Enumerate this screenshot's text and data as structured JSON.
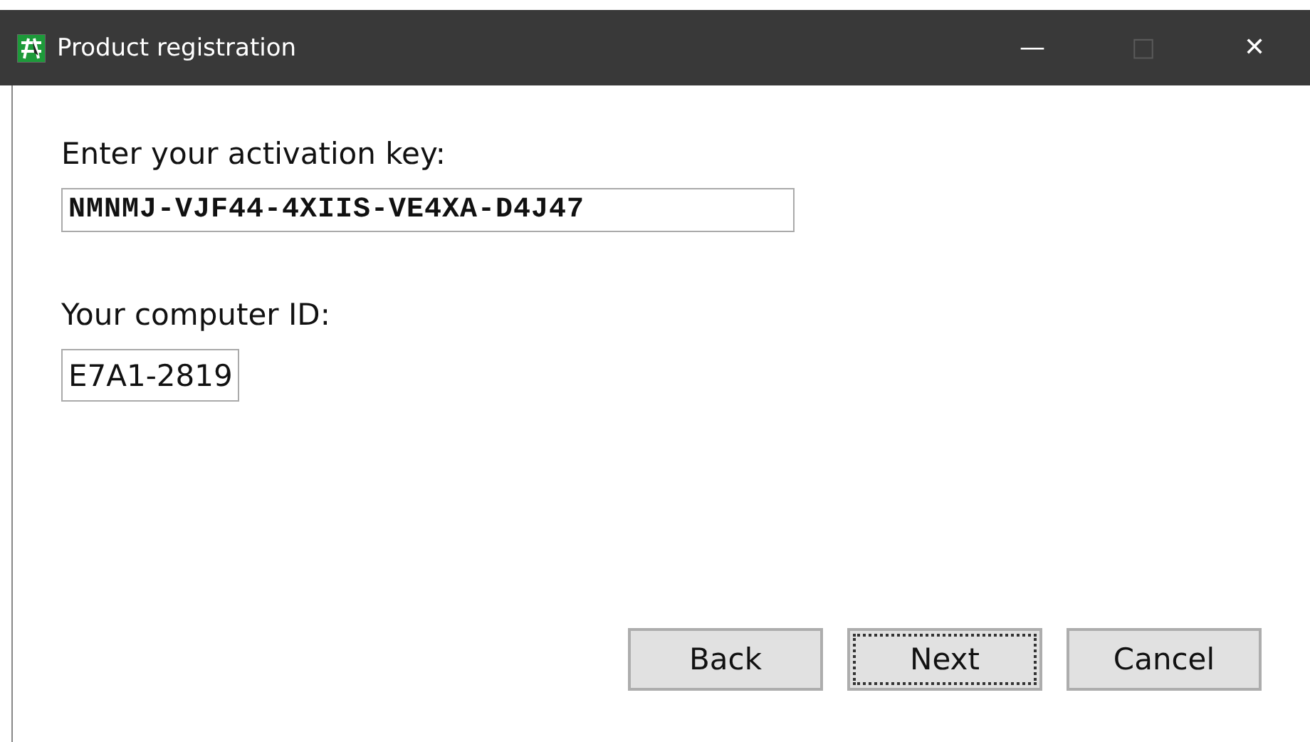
{
  "window": {
    "title": "Product registration",
    "controls": [
      "—",
      "□",
      "✕"
    ]
  },
  "fields": [
    {
      "label": "Enter your activation key:",
      "value": "NMNMJ-VJF44-4XIIS-VE4XA-D4J47",
      "kind": "mono"
    },
    {
      "label": "Your computer ID:",
      "value": "E7A1-2819",
      "kind": "plain"
    }
  ],
  "buttons": [
    {
      "label": "Back",
      "focused": false
    },
    {
      "label": "Next",
      "focused": true
    },
    {
      "label": "Cancel",
      "focused": false
    }
  ]
}
